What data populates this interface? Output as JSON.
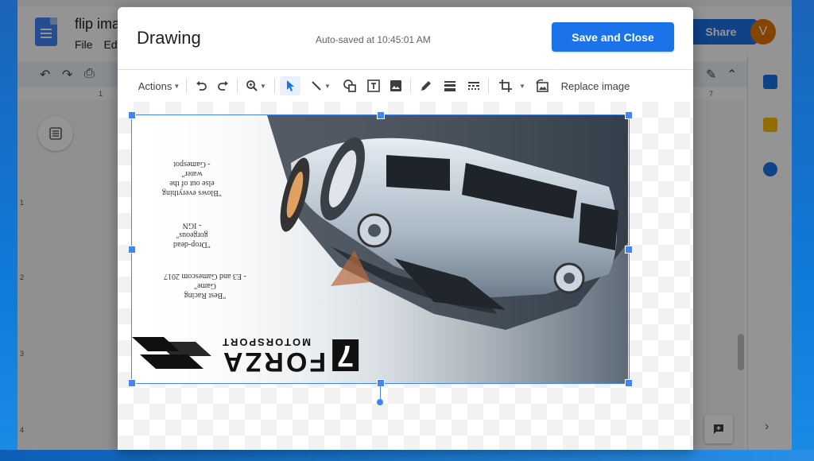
{
  "docs": {
    "title": "flip ima",
    "menu": [
      "File",
      "Ed"
    ],
    "share_label": "Share",
    "avatar_letter": "V",
    "ruler_top": [
      "1",
      "7"
    ],
    "ruler_left": [
      "1",
      "2",
      "3",
      "4"
    ]
  },
  "dialog": {
    "title": "Drawing",
    "autosave": "Auto-saved at 10:45:01 AM",
    "save_close_label": "Save and Close"
  },
  "toolbar": {
    "actions_label": "Actions",
    "replace_image_label": "Replace image"
  },
  "image": {
    "quotes": [
      "\"Best Racing\nGame\"\n- E3 and Gamescom 2017",
      "\"Drop-dead\ngorgeous\"\n- IGN",
      "\"Blows everything\nelse out of the\nwater\"\n- Gamespot"
    ],
    "brand_main": "FORZA",
    "brand_number": "7",
    "brand_sub": "MOTORSPORT"
  },
  "colors": {
    "accent": "#1a73e8",
    "selection": "#4285f4",
    "avatar": "#e37400"
  }
}
